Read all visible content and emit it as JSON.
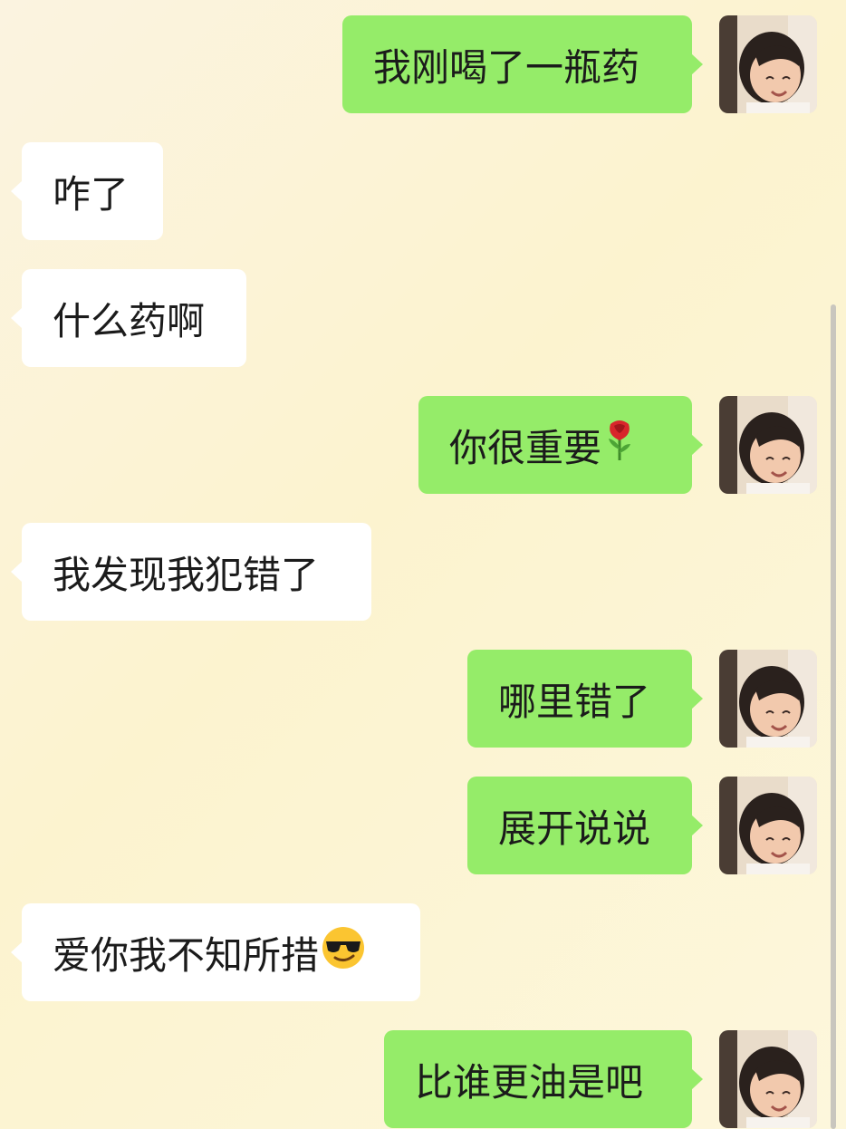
{
  "chat": {
    "messages": [
      {
        "side": "out",
        "text": "我刚喝了一瓶药"
      },
      {
        "side": "in",
        "text": "咋了"
      },
      {
        "side": "in",
        "text": "什么药啊"
      },
      {
        "side": "out",
        "text": "你很重要",
        "emoji": "rose"
      },
      {
        "side": "in",
        "text": "我发现我犯错了"
      },
      {
        "side": "out",
        "text": "哪里错了"
      },
      {
        "side": "out",
        "text": "展开说说"
      },
      {
        "side": "in",
        "text": "爱你我不知所措",
        "emoji": "smiling-face-with-sunglasses"
      },
      {
        "side": "out",
        "text": "比谁更油是吧"
      }
    ]
  },
  "colors": {
    "outgoing_bubble": "#95ec69",
    "incoming_bubble": "#ffffff",
    "background": "#fcf3cf"
  },
  "icons": {
    "avatar": "user-avatar-photo"
  }
}
